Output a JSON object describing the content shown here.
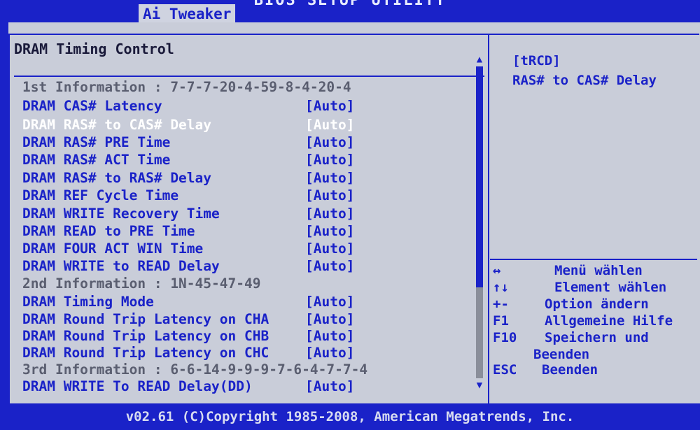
{
  "header": {
    "utility_title": "BIOS SETUP UTILITY",
    "active_tab": "Ai Tweaker"
  },
  "main": {
    "section_title": "DRAM Timing Control",
    "rows": [
      {
        "label": "1st Information : 7-7-7-20-4-59-8-4-20-4",
        "value": "",
        "kind": "info"
      },
      {
        "label": "DRAM CAS# Latency",
        "value": "[Auto]",
        "kind": "setting"
      },
      {
        "label": "DRAM RAS# to CAS# Delay",
        "value": "[Auto]",
        "kind": "selected"
      },
      {
        "label": "DRAM RAS# PRE Time",
        "value": "[Auto]",
        "kind": "setting"
      },
      {
        "label": "DRAM RAS# ACT Time",
        "value": "[Auto]",
        "kind": "setting"
      },
      {
        "label": "DRAM RAS# to RAS# Delay",
        "value": "[Auto]",
        "kind": "setting"
      },
      {
        "label": "DRAM REF Cycle Time",
        "value": "[Auto]",
        "kind": "setting"
      },
      {
        "label": "DRAM WRITE Recovery Time",
        "value": "[Auto]",
        "kind": "setting"
      },
      {
        "label": "DRAM READ to PRE Time",
        "value": "[Auto]",
        "kind": "setting"
      },
      {
        "label": "DRAM FOUR ACT WIN Time",
        "value": "[Auto]",
        "kind": "setting"
      },
      {
        "label": "DRAM WRITE to READ Delay",
        "value": "[Auto]",
        "kind": "setting"
      },
      {
        "label": "2nd Information : 1N-45-47-49",
        "value": "",
        "kind": "info"
      },
      {
        "label": "DRAM Timing Mode",
        "value": "[Auto]",
        "kind": "setting"
      },
      {
        "label": "DRAM Round Trip Latency on CHA",
        "value": "[Auto]",
        "kind": "setting"
      },
      {
        "label": "DRAM Round Trip Latency on CHB",
        "value": "[Auto]",
        "kind": "setting"
      },
      {
        "label": "DRAM Round Trip Latency on CHC",
        "value": "[Auto]",
        "kind": "setting"
      },
      {
        "label": "3rd Information : 6-6-14-9-9-9-7-6-4-7-7-4",
        "value": "",
        "kind": "info"
      },
      {
        "label": "DRAM WRITE To READ Delay(DD)",
        "value": "[Auto]",
        "kind": "setting"
      }
    ]
  },
  "scrollbar": {
    "up_glyph": "▲",
    "down_glyph": "▼"
  },
  "help": {
    "tag": "[tRCD]",
    "description": "RAS# to CAS# Delay"
  },
  "legend": [
    {
      "key": "↔",
      "desc": "Menü wählen"
    },
    {
      "key": "↑↓",
      "desc": "Element wählen"
    },
    {
      "key": "+-",
      "desc": "Option ändern"
    },
    {
      "key": "F1",
      "desc": "Allgemeine Hilfe"
    },
    {
      "key": "F10",
      "desc": "Speichern und"
    },
    {
      "key": "",
      "desc": "Beenden"
    },
    {
      "key": "ESC",
      "desc": "Beenden"
    }
  ],
  "footer": {
    "copyright": "v02.61 (C)Copyright 1985-2008, American Megatrends, Inc."
  },
  "colors": {
    "frame_blue": "#1a22c8",
    "panel_gray": "#c9cdd9",
    "selected_text": "#ffffff",
    "info_text": "#5a5e70"
  }
}
